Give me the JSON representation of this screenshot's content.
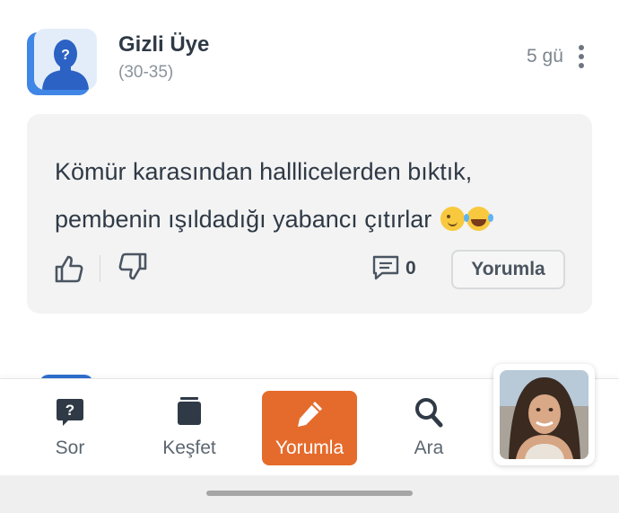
{
  "post": {
    "author": "Gizli Üye",
    "age_range": "(30-35)",
    "time_ago": "5 gü",
    "text_line1": "Kömür karasından halllicelerden bıktık,",
    "text_line2": "pembenin ışıldadığı yabancı çıtırlar",
    "emojis": [
      "winking-face",
      "face-with-tears-of-joy"
    ],
    "comment_count": "0",
    "reply_button": "Yorumla"
  },
  "nav": {
    "items": [
      {
        "label": "Sor",
        "icon": "question-bubble-icon"
      },
      {
        "label": "Keşfet",
        "icon": "stack-icon"
      },
      {
        "label": "Yorumla",
        "icon": "pencil-icon",
        "active": true
      },
      {
        "label": "Ara",
        "icon": "search-icon"
      }
    ]
  },
  "colors": {
    "accent": "#e56b2c",
    "avatar_blue": "#3f86e6",
    "card_bg": "#f3f3f3",
    "nav_icon": "#2f3a46"
  }
}
